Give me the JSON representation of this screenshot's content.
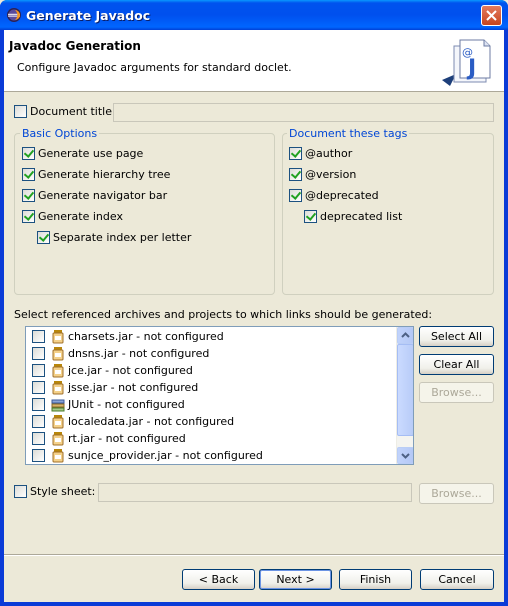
{
  "window": {
    "title": "Generate Javadoc"
  },
  "banner": {
    "title": "Javadoc Generation",
    "description": "Configure Javadoc arguments for standard doclet."
  },
  "document_title": {
    "label": "Document title:",
    "checked": false,
    "value": ""
  },
  "basic_options": {
    "title": "Basic Options",
    "items": [
      {
        "label": "Generate use page",
        "checked": true
      },
      {
        "label": "Generate hierarchy tree",
        "checked": true
      },
      {
        "label": "Generate navigator bar",
        "checked": true
      },
      {
        "label": "Generate index",
        "checked": true
      },
      {
        "label": "Separate index per letter",
        "checked": true
      }
    ]
  },
  "document_tags": {
    "title": "Document these tags",
    "items": [
      {
        "label": "@author",
        "checked": true
      },
      {
        "label": "@version",
        "checked": true
      },
      {
        "label": "@deprecated",
        "checked": true
      },
      {
        "label": "deprecated list",
        "checked": true
      }
    ]
  },
  "links": {
    "label": "Select referenced archives and projects to which links should be generated:",
    "items": [
      {
        "label": "charsets.jar - not configured",
        "checked": false
      },
      {
        "label": "dnsns.jar - not configured",
        "checked": false
      },
      {
        "label": "jce.jar - not configured",
        "checked": false
      },
      {
        "label": "jsse.jar - not configured",
        "checked": false
      },
      {
        "label": "JUnit - not configured",
        "checked": false
      },
      {
        "label": "localedata.jar - not configured",
        "checked": false
      },
      {
        "label": "rt.jar - not configured",
        "checked": false
      },
      {
        "label": "sunjce_provider.jar - not configured",
        "checked": false
      }
    ],
    "select_all": "Select All",
    "clear_all": "Clear All",
    "browse": "Browse..."
  },
  "style_sheet": {
    "label": "Style sheet:",
    "checked": false,
    "value": "",
    "browse": "Browse..."
  },
  "footer": {
    "back": "< Back",
    "next": "Next >",
    "finish": "Finish",
    "cancel": "Cancel"
  },
  "colors": {
    "titlebar": "#0053ee",
    "group_title": "#0046d5",
    "check": "#21a121"
  }
}
